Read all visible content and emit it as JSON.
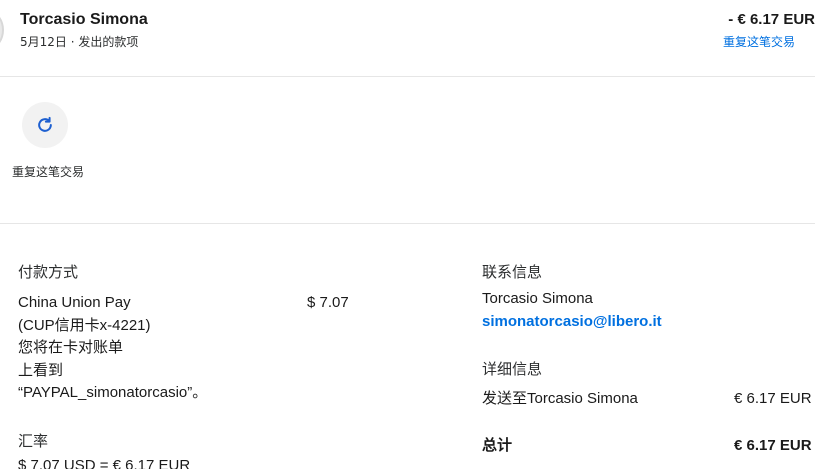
{
  "header": {
    "name": "Torcasio Simona",
    "subtitle": "5月12日 · 发出的款项",
    "amount": "- € 6.17 EUR",
    "repeat_link": "重复这笔交易"
  },
  "actions": {
    "repeat_label": "重复这笔交易",
    "repeat_icon": "refresh-icon"
  },
  "payment": {
    "heading": "付款方式",
    "method_line1": "China Union Pay",
    "method_line2": "(CUP信用卡x-4221)",
    "method_line3": "您将在卡对账单",
    "method_line4": "上看到",
    "method_line5": "“PAYPAL_simonatorcasio”。",
    "amount": "$ 7.07"
  },
  "exchange": {
    "heading": "汇率",
    "rate": "$ 7.07 USD = € 6.17 EUR"
  },
  "contact": {
    "heading": "联系信息",
    "name": "Torcasio Simona",
    "email": "simonatorcasio@libero.it"
  },
  "details": {
    "heading": "详细信息",
    "sent_to_label": "发送至Torcasio Simona",
    "sent_to_amount": "€ 6.17 EUR",
    "total_label": "总计",
    "total_amount": "€ 6.17 EUR"
  },
  "colors": {
    "link": "#0070e0",
    "divider": "#e6e6e6",
    "action_bg": "#f2f2f2"
  }
}
